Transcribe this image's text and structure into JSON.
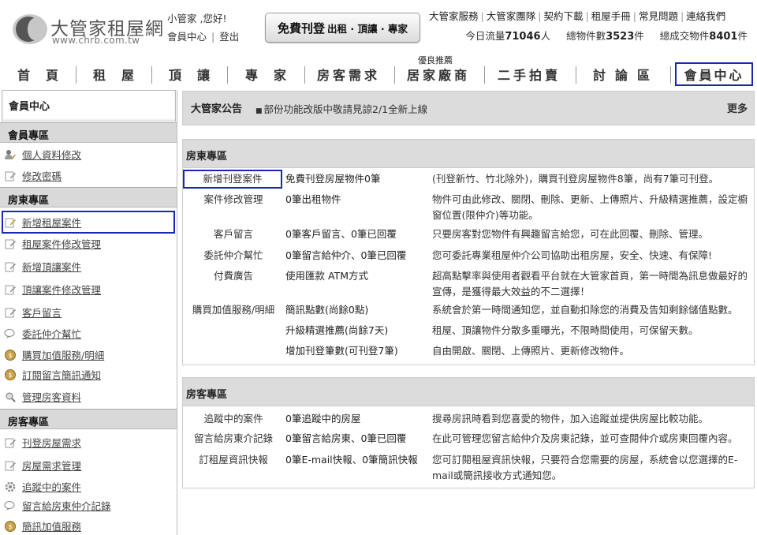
{
  "brand": {
    "name": "大管家租屋網",
    "url": "www.chrb.com.tw"
  },
  "user": {
    "greeting": "小管家 ,您好!",
    "member_center": "會員中心",
    "logout": "登出"
  },
  "free_post": {
    "main": "免費刊登",
    "sub": "出租 · 頂讓 · 專家"
  },
  "top_links": [
    "大管家服務",
    "大管家團隊",
    "契約下載",
    "租屋手冊",
    "常見問題",
    "連絡我們"
  ],
  "stats": {
    "traffic_label": "今日流量",
    "traffic": "71046",
    "traffic_unit": "人",
    "listings_label": "總物件數",
    "listings": "3523",
    "listings_unit": "件",
    "deals_label": "總成交物件",
    "deals": "8401",
    "deals_unit": "件"
  },
  "nav": {
    "items": [
      "首頁",
      "租屋",
      "頂讓",
      "專家",
      "房客需求",
      "居家廠商",
      "二手拍賣",
      "討論區",
      "會員中心"
    ],
    "badge": "優良推薦"
  },
  "sidebar": {
    "title": "會員中心",
    "sections": [
      {
        "title": "會員專區",
        "items": [
          "個人資料修改",
          "修改密碼"
        ]
      },
      {
        "title": "房東專區",
        "items": [
          "新增租屋案件",
          "租屋案件修改管理",
          "新增頂讓案件",
          "頂讓案件修改管理",
          "客戶留言",
          "委託仲介幫忙",
          "購買加值服務/明細",
          "訂閱留言簡訊通知",
          "管理房客資料"
        ]
      },
      {
        "title": "房客專區",
        "items": [
          "刊登房屋需求",
          "房屋需求管理",
          "追蹤中的案件",
          "留言給房東仲介記錄",
          "簡訊加值服務"
        ]
      }
    ]
  },
  "notice": {
    "label": "大管家公告",
    "text": "部份功能改版中敬請見諒2/1全新上線",
    "more": "更多"
  },
  "landlord": {
    "title": "房東專區",
    "rows": [
      {
        "name": "新增刊登案件",
        "status": "免費刊登房屋物件0筆",
        "desc": "(刊登新竹、竹北除外)，購買刊登房屋物件8筆，尚有7筆可刊登。"
      },
      {
        "name": "案件修改管理",
        "status": "0筆出租物件",
        "desc": "物件可由此修改、關閉、刪除、更新、上傳照片、升級精選推薦，設定櫥窗位置(限仲介)等功能。"
      },
      {
        "name": "客戶留言",
        "status": "0筆客戶留言、0筆已回覆",
        "desc": "只要房客對您物件有興趣留言給您，可在此回覆、刪除、管理。"
      },
      {
        "name": "委託仲介幫忙",
        "status": "0筆留言給仲介、0筆已回覆",
        "desc": "您可委託專業租屋仲介公司協助出租房屋，安全、快速、有保障!"
      },
      {
        "name": "付費廣告",
        "status": "使用匯款 ATM方式",
        "desc": "超高點擊率與使用者觀看平台就在大管家首頁，第一時間為訊息做最好的宣傳，是獲得最大效益的不二選擇！"
      },
      {
        "name": "購買加值服務/明細",
        "status": "簡訊點數(尚餘0點)",
        "desc": "系統會於第一時間通知您，並自動扣除您的消費及告知剩餘儲值點數。"
      },
      {
        "name": "",
        "status": "升級精選推薦(尚餘7天)",
        "desc": "租屋、頂讓物件分散多重曝光，不限時間使用，可保留天數。"
      },
      {
        "name": "",
        "status": "增加刊登筆數(可刊登7筆)",
        "desc": "自由開啟、關閉、上傳照片、更新修改物件。"
      }
    ]
  },
  "tenant": {
    "title": "房客專區",
    "rows": [
      {
        "name": "追蹤中的案件",
        "status": "0筆追蹤中的房屋",
        "desc": "搜尋房訊時看到您喜愛的物件，加入追蹤並提供房屋比較功能。"
      },
      {
        "name": "留言給房東介記錄",
        "status": "0筆留言給房東、0筆已回覆",
        "desc": "在此可管理您留言給仲介及房東記錄，並可查閱仲介或房東回覆內容。"
      },
      {
        "name": "訂租屋資訊快報",
        "status": "0筆E-mail快報、0筆簡訊快報",
        "desc": "您可訂閱租屋資訊快報，只要符合您需要的房屋，系統會以您選擇的E-mail或簡訊接收方式通知您。"
      }
    ]
  },
  "colors": {
    "highlight": "#1a26b5",
    "panel_head": "#dcdcdc",
    "sidebar_head": "#d9d9d9"
  },
  "icons": {
    "user": "user-edit-icon",
    "pencil": "pencil-icon",
    "chat": "chat-icon",
    "coin": "coin-icon",
    "gear": "gear-icon",
    "search": "search-user-icon"
  }
}
